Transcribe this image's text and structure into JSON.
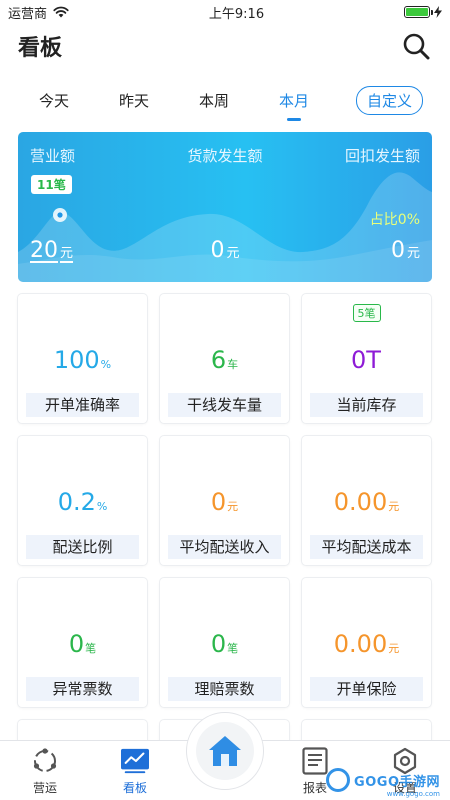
{
  "status_bar": {
    "carrier": "运营商",
    "time": "上午9:16"
  },
  "header": {
    "title": "看板"
  },
  "tabs": [
    {
      "label": "今天",
      "active": false
    },
    {
      "label": "昨天",
      "active": false
    },
    {
      "label": "本周",
      "active": false
    },
    {
      "label": "本月",
      "active": true
    }
  ],
  "custom_tab": {
    "label": "自定义"
  },
  "summary": {
    "col1": {
      "label": "营业额",
      "value": "20",
      "unit": "元",
      "badge": "11笔"
    },
    "col2": {
      "label": "货款发生额",
      "value": "0",
      "unit": "元"
    },
    "col3": {
      "label": "回扣发生额",
      "value": "0",
      "unit": "元",
      "note": "占比0%"
    }
  },
  "metrics": [
    {
      "label": "开单准确率",
      "value": "100",
      "unit": "%",
      "color": "#25a9e7"
    },
    {
      "label": "干线发车量",
      "value": "6",
      "unit": "车",
      "color": "#2bb64b"
    },
    {
      "label": "当前库存",
      "value": "0T",
      "unit": "",
      "color": "#8e1bd6",
      "note": "5笔"
    },
    {
      "label": "配送比例",
      "value": "0.2",
      "unit": "%",
      "color": "#25a9e7"
    },
    {
      "label": "平均配送收入",
      "value": "0",
      "unit": "元",
      "color": "#f5952c"
    },
    {
      "label": "平均配送成本",
      "value": "0.00",
      "unit": "元",
      "color": "#f5952c"
    },
    {
      "label": "异常票数",
      "value": "0",
      "unit": "笔",
      "color": "#2bb64b"
    },
    {
      "label": "理赔票数",
      "value": "0",
      "unit": "笔",
      "color": "#2bb64b"
    },
    {
      "label": "开单保险",
      "value": "0.00",
      "unit": "元",
      "color": "#f5952c"
    }
  ],
  "tabbar": {
    "items": [
      {
        "label": "营运",
        "icon": "operations-icon",
        "active": false
      },
      {
        "label": "看板",
        "icon": "dashboard-icon",
        "active": true
      },
      {
        "label": "报表",
        "icon": "report-icon",
        "active": false
      },
      {
        "label": "设置",
        "icon": "settings-icon",
        "active": false
      }
    ],
    "home_icon": "home-icon"
  },
  "watermark": {
    "brand": "GOGO手游网",
    "url": "www.gogo.com"
  }
}
